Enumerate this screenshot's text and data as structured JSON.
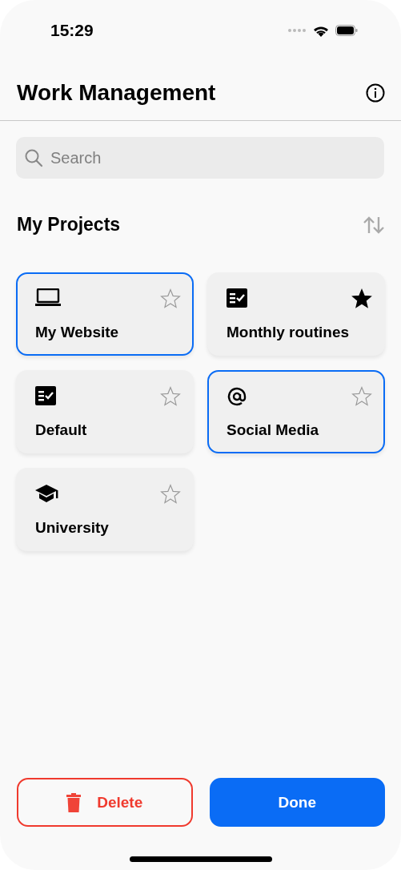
{
  "status_bar": {
    "time": "15:29"
  },
  "header": {
    "title": "Work Management"
  },
  "search": {
    "placeholder": "Search"
  },
  "section": {
    "title": "My Projects"
  },
  "projects": [
    {
      "name": "My Website",
      "kind": "laptop",
      "selected": true,
      "starred": false
    },
    {
      "name": "Monthly routines",
      "kind": "checklist",
      "selected": false,
      "starred": true
    },
    {
      "name": "Default",
      "kind": "checklist",
      "selected": false,
      "starred": false
    },
    {
      "name": "Social Media",
      "kind": "at",
      "selected": true,
      "starred": false
    },
    {
      "name": "University",
      "kind": "school",
      "selected": false,
      "starred": false
    }
  ],
  "actions": [
    {
      "label": "Delete",
      "kind": "destructive"
    },
    {
      "label": "Done",
      "kind": "primary"
    }
  ]
}
